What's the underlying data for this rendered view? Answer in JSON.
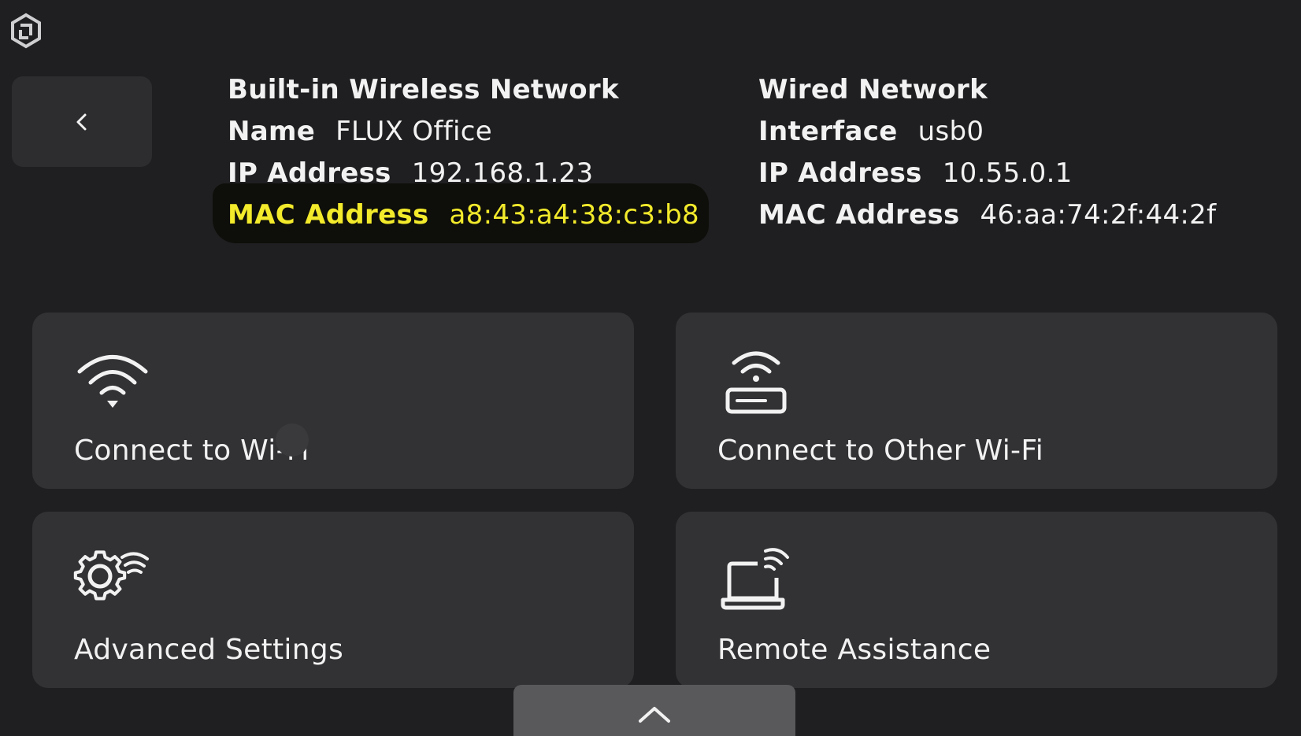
{
  "header": {
    "logo_icon": "flux-logo-icon"
  },
  "back_button": {
    "icon": "chevron-left-icon"
  },
  "wireless": {
    "title": "Built-in Wireless Network",
    "name_label": "Name",
    "name_value": "FLUX Office",
    "ip_label": "IP Address",
    "ip_value": "192.168.1.23",
    "mac_label": "MAC Address",
    "mac_value": "a8:43:a4:38:c3:b8"
  },
  "wired": {
    "title": "Wired Network",
    "interface_label": "Interface",
    "interface_value": "usb0",
    "ip_label": "IP Address",
    "ip_value": "10.55.0.1",
    "mac_label": "MAC Address",
    "mac_value": "46:aa:74:2f:44:2f"
  },
  "tiles": [
    {
      "label": "Connect to Wi-Fi",
      "icon": "wifi-icon"
    },
    {
      "label": "Connect to Other Wi-Fi",
      "icon": "wifi-router-icon"
    },
    {
      "label": "Advanced Settings",
      "icon": "gear-wifi-icon"
    },
    {
      "label": "Remote Assistance",
      "icon": "laptop-signal-icon"
    }
  ],
  "bottom_tab": {
    "icon": "chevron-up-icon"
  },
  "colors": {
    "background": "#1f1f21",
    "tile": "#323235",
    "highlight_text": "#f2ea2b"
  }
}
